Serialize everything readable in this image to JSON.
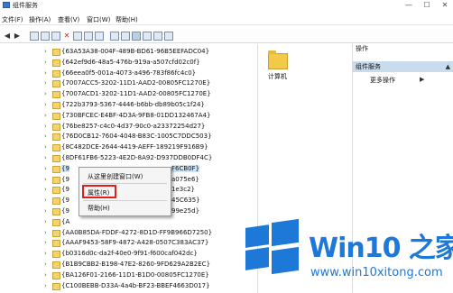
{
  "window": {
    "title": "组件服务",
    "controls": [
      "—",
      "☐",
      "✕"
    ]
  },
  "menu": [
    "文件(F)",
    "操作(A)",
    "查看(V)",
    "窗口(W)",
    "帮助(H)"
  ],
  "toolbar": {
    "buttons": [
      "back-icon",
      "forward-icon",
      "up-icon",
      "show-tree-icon",
      "copy-icon",
      "delete-icon",
      "refresh-icon",
      "export-icon",
      "help-icon",
      "large-icons-icon",
      "small-icons-icon",
      "list-icon",
      "details-icon",
      "new-icon",
      "properties-icon"
    ]
  },
  "tree": {
    "items": [
      "{63A53A38-004F-489B-BD61-96B5EEFADC04}",
      "{642ef9d6-48a5-476b-919a-a507cfd02c0f}",
      "{66eea0f5-001a-4073-a496-783f86fc4c0}",
      "{7007ACC5-3202-11D1-AAD2-00805FC1270E}",
      "{7007ACD1-3202-11D1-AAD2-00805FC1270E}",
      "{722b3793-5367-4446-b6bb-db89b05c1f24}",
      "{730BFCEC-E4BF-4D3A-9FB8-01DD132467A4}",
      "{76be8257-c4c0-4d37-90c0-a23372254d27}",
      "{76D0CB12-7604-4048-B83C-1005C7DDC503}",
      "{8C482DCE-2644-4419-AEFF-189219F916B9}",
      "{8DF61FB6-5223-4E2D-8A92-D937DDB0DF4C}",
      "{9",
      "{9",
      "{9",
      "{9",
      "{9",
      "{A",
      "{AA0B85DA-FDDF-4272-8D1D-FF9B966D7250}",
      "{AAAF9453-58F9-4872-A428-0507C383AC37}",
      "{b0316d0c-da2f-40e0-9f91-f600caf042dc}",
      "{B1B9CBB2-B198-47E2-8260-9FD629A2B2EC}",
      "{BA126F01-2166-11D1-B1D0-00805FC1270E}",
      "{C100BEBB-D33A-4a4b-BF23-BBEF4663D017}"
    ],
    "suffixes": [
      "F6CB0F}",
      "a075e6}",
      "1e3c2}",
      "45C635}",
      "99e25d}"
    ]
  },
  "context_menu": {
    "items": [
      "从这里创建窗口(W)",
      "属性(R)",
      "帮助(H)"
    ]
  },
  "center": {
    "folder_label": "计算机"
  },
  "actions": {
    "header": "操作",
    "group": "组件服务",
    "collapse": "▲",
    "more": "更多操作",
    "more_arrow": "▶"
  },
  "watermark": {
    "brand": "Win10 之家",
    "url": "www.win10xitong.com",
    "colors": {
      "blue": "#1e78d7"
    }
  },
  "colors": {
    "selection": "#cce4f7",
    "action_bar": "#c9dcee",
    "highlight_box": "#e02020"
  }
}
